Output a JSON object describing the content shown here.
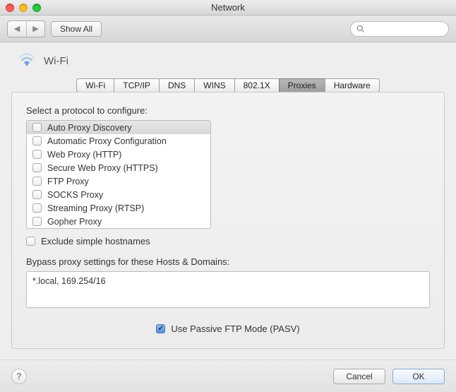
{
  "window": {
    "title": "Network"
  },
  "toolbar": {
    "back_label": "◀",
    "fwd_label": "▶",
    "show_all": "Show All"
  },
  "header": {
    "connection_name": "Wi-Fi"
  },
  "tabs": [
    {
      "label": "Wi-Fi",
      "selected": false
    },
    {
      "label": "TCP/IP",
      "selected": false
    },
    {
      "label": "DNS",
      "selected": false
    },
    {
      "label": "WINS",
      "selected": false
    },
    {
      "label": "802.1X",
      "selected": false
    },
    {
      "label": "Proxies",
      "selected": true
    },
    {
      "label": "Hardware",
      "selected": false
    }
  ],
  "proxies": {
    "select_label": "Select a protocol to configure:",
    "protocols": [
      {
        "label": "Auto Proxy Discovery",
        "checked": false,
        "selected": true
      },
      {
        "label": "Automatic Proxy Configuration",
        "checked": false,
        "selected": false
      },
      {
        "label": "Web Proxy (HTTP)",
        "checked": false,
        "selected": false
      },
      {
        "label": "Secure Web Proxy (HTTPS)",
        "checked": false,
        "selected": false
      },
      {
        "label": "FTP Proxy",
        "checked": false,
        "selected": false
      },
      {
        "label": "SOCKS Proxy",
        "checked": false,
        "selected": false
      },
      {
        "label": "Streaming Proxy (RTSP)",
        "checked": false,
        "selected": false
      },
      {
        "label": "Gopher Proxy",
        "checked": false,
        "selected": false
      }
    ],
    "exclude_simple_label": "Exclude simple hostnames",
    "exclude_simple_checked": false,
    "bypass_label": "Bypass proxy settings for these Hosts & Domains:",
    "bypass_value": "*.local, 169.254/16",
    "passive_ftp_label": "Use Passive FTP Mode (PASV)",
    "passive_ftp_checked": true
  },
  "footer": {
    "help": "?",
    "cancel": "Cancel",
    "ok": "OK"
  }
}
